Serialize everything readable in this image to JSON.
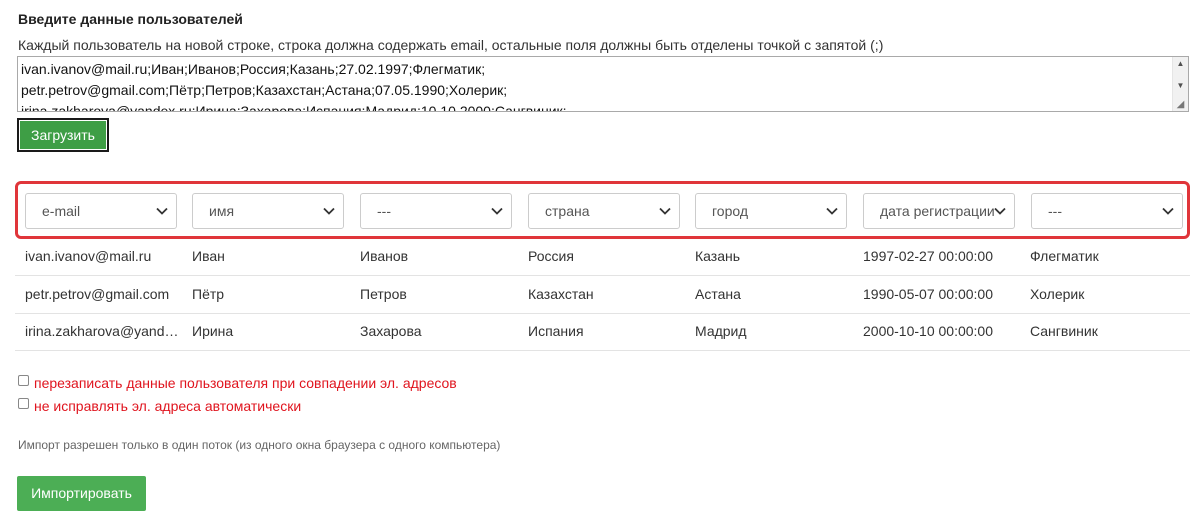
{
  "form": {
    "title": "Введите данные пользователей",
    "hint": "Каждый пользователь на новой строке, строка должна содержать email, остальные поля должны быть отделены точкой с запятой (;)",
    "textarea_lines": [
      "ivan.ivanov@mail.ru;Иван;Иванов;Россия;Казань;27.02.1997;Флегматик;",
      "petr.petrov@gmail.com;Пётр;Петров;Казахстан;Астана;07.05.1990;Холерик;",
      "irina.zakharova@yandex.ru;Ирина;Захарова;Испания;Мадрид;10.10.2000;Сангвиник;"
    ],
    "load_button": "Загрузить"
  },
  "mapping": {
    "selects": [
      {
        "value": "e-mail"
      },
      {
        "value": "имя"
      },
      {
        "value": "---"
      },
      {
        "value": "страна"
      },
      {
        "value": "город"
      },
      {
        "value": "дата регистрации"
      },
      {
        "value": "---"
      }
    ]
  },
  "preview": {
    "rows": [
      [
        "ivan.ivanov@mail.ru",
        "Иван",
        "Иванов",
        "Россия",
        "Казань",
        "1997-02-27 00:00:00",
        "Флегматик"
      ],
      [
        "petr.petrov@gmail.com",
        "Пётр",
        "Петров",
        "Казахстан",
        "Астана",
        "1990-05-07 00:00:00",
        "Холерик"
      ],
      [
        "irina.zakharova@yandex.ru",
        "Ирина",
        "Захарова",
        "Испания",
        "Мадрид",
        "2000-10-10 00:00:00",
        "Сангвиник"
      ]
    ]
  },
  "options": {
    "overwrite": "перезаписать данные пользователя при совпадении эл. адресов",
    "no_fix_email": "не исправлять эл. адреса автоматически"
  },
  "note": "Импорт разрешен только в один поток (из одного окна браузера с одного компьютера)",
  "import_button": "Импортировать",
  "colors": {
    "load_button": "#3e9e45",
    "import_button": "#4cae55",
    "highlight_border": "#e0353a",
    "option_text": "#e0141e"
  }
}
